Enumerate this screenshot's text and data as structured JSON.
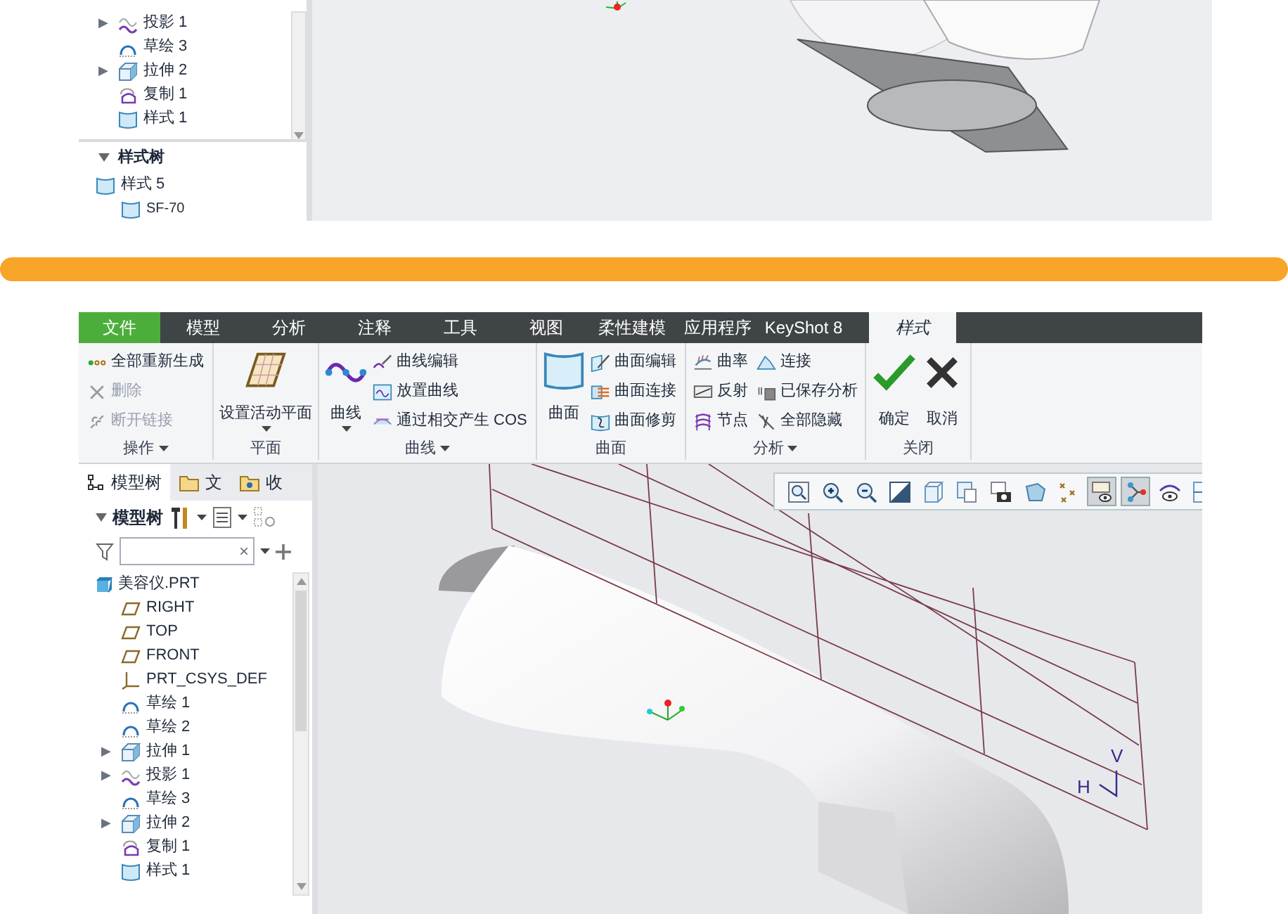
{
  "top_panel": {
    "tree_items": [
      {
        "label": "投影 1",
        "kind": "projection",
        "arrow": "▶"
      },
      {
        "label": "草绘 3",
        "kind": "sketch"
      },
      {
        "label": "拉伸 2",
        "kind": "extrude",
        "arrow": "▶"
      },
      {
        "label": "复制 1",
        "kind": "copy"
      },
      {
        "label": "样式 1",
        "kind": "style"
      }
    ],
    "style_tree": {
      "title": "样式树",
      "items": [
        {
          "label": "样式 5",
          "children": [
            {
              "label": "SF-70"
            }
          ]
        }
      ]
    }
  },
  "app": {
    "ribbon_tabs": [
      {
        "label": "文件",
        "kind": "file",
        "selected": false
      },
      {
        "label": "模型",
        "kind": "tab",
        "selected": false
      },
      {
        "label": "分析",
        "kind": "tab",
        "selected": false
      },
      {
        "label": "注释",
        "kind": "tab",
        "selected": false
      },
      {
        "label": "工具",
        "kind": "tab",
        "selected": false
      },
      {
        "label": "视图",
        "kind": "tab",
        "selected": false
      },
      {
        "label": "柔性建模",
        "kind": "tab",
        "selected": false
      },
      {
        "label": "应用程序",
        "kind": "tab",
        "selected": false
      },
      {
        "label": "KeyShot 8",
        "kind": "tab",
        "selected": false
      },
      {
        "label": "样式",
        "kind": "tab",
        "selected": true
      }
    ],
    "ribbon_groups": [
      {
        "label": "操作",
        "dropdown": true,
        "kind": "list",
        "items": [
          {
            "label": "全部重新生成",
            "disabled": false
          },
          {
            "label": "删除",
            "disabled": true
          },
          {
            "label": "断开链接",
            "disabled": true
          }
        ]
      },
      {
        "label": "平面",
        "dropdown": false,
        "kind": "large",
        "items": [
          {
            "label": "设置活动平面",
            "dropdown": true
          }
        ]
      },
      {
        "label": "曲线",
        "dropdown": true,
        "kind": "mixed",
        "items": [
          {
            "label": "曲线",
            "dropdown": true
          },
          {
            "label": "曲线编辑"
          },
          {
            "label": "放置曲线"
          },
          {
            "label": "通过相交产生 COS"
          }
        ]
      },
      {
        "label": "曲面",
        "dropdown": false,
        "kind": "mixed",
        "items": [
          {
            "label": "曲面",
            "dropdown": false
          },
          {
            "label": "曲面编辑"
          },
          {
            "label": "曲面连接"
          },
          {
            "label": "曲面修剪"
          }
        ]
      },
      {
        "label": "分析",
        "dropdown": true,
        "kind": "grid",
        "items": [
          {
            "label": "曲率"
          },
          {
            "label": "连接"
          },
          {
            "label": "反射"
          },
          {
            "label": "已保存分析"
          },
          {
            "label": "节点"
          },
          {
            "label": "全部隐藏"
          }
        ]
      },
      {
        "label": "关闭",
        "dropdown": false,
        "kind": "close",
        "items": [
          {
            "label": "确定"
          },
          {
            "label": "取消"
          }
        ]
      }
    ],
    "panel_tabs": [
      {
        "label": "模型树",
        "kind": "tree",
        "selected": true
      },
      {
        "label": "文",
        "kind": "folder",
        "selected": false
      },
      {
        "label": "收",
        "kind": "favorites",
        "selected": false
      }
    ],
    "model_tree": {
      "title": "模型树",
      "search": {
        "clear": "×"
      },
      "root": {
        "label": "美容仪.PRT",
        "children": [
          {
            "label": "RIGHT",
            "kind": "plane"
          },
          {
            "label": "TOP",
            "kind": "plane"
          },
          {
            "label": "FRONT",
            "kind": "plane"
          },
          {
            "label": "PRT_CSYS_DEF",
            "kind": "csys"
          },
          {
            "label": "草绘 1",
            "kind": "sketch"
          },
          {
            "label": "草绘 2",
            "kind": "sketch"
          },
          {
            "label": "拉伸 1",
            "kind": "extrude",
            "arrow": "▶"
          },
          {
            "label": "投影 1",
            "kind": "projection",
            "arrow": "▶"
          },
          {
            "label": "草绘 3",
            "kind": "sketch"
          },
          {
            "label": "拉伸 2",
            "kind": "extrude",
            "arrow": "▶"
          },
          {
            "label": "复制 1",
            "kind": "copy"
          },
          {
            "label": "样式 1",
            "kind": "style"
          }
        ]
      }
    },
    "view_toolbar": [
      {
        "kind": "refit",
        "pressed": false
      },
      {
        "kind": "zoomin",
        "pressed": false
      },
      {
        "kind": "zoomout",
        "pressed": false
      },
      {
        "kind": "repaint",
        "pressed": false
      },
      {
        "kind": "orient",
        "pressed": false
      },
      {
        "kind": "views",
        "pressed": false
      },
      {
        "kind": "snapshot",
        "pressed": false
      },
      {
        "kind": "shading",
        "pressed": false
      },
      {
        "kind": "datum",
        "pressed": false
      },
      {
        "kind": "layer",
        "pressed": true
      },
      {
        "kind": "points",
        "pressed": true
      },
      {
        "kind": "visibility",
        "pressed": false
      },
      {
        "kind": "grid",
        "pressed": false
      }
    ],
    "viewport": {
      "plane_labels": {
        "h": "H",
        "v": "V"
      }
    }
  }
}
